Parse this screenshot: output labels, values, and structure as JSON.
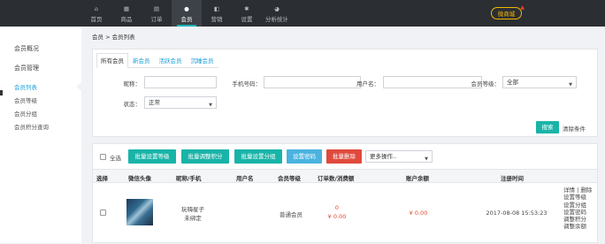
{
  "topnav": [
    {
      "label": "首页",
      "icon": "home-icon",
      "glyph": "⌂"
    },
    {
      "label": "商品",
      "icon": "goods-icon",
      "glyph": "▦"
    },
    {
      "label": "订单",
      "icon": "order-icon",
      "glyph": "▤"
    },
    {
      "label": "会员",
      "icon": "member-icon",
      "glyph": "●"
    },
    {
      "label": "营销",
      "icon": "marketing-icon",
      "glyph": "◧"
    },
    {
      "label": "设置",
      "icon": "settings-icon",
      "glyph": "✱"
    },
    {
      "label": "分析统计",
      "icon": "analytics-icon",
      "glyph": "◕"
    }
  ],
  "topnav_active": "会员",
  "weishop_label": "微商城",
  "sidebar": {
    "overview": "会员概况",
    "manage_group": "会员管理",
    "links": [
      "会员列表",
      "会员等级",
      "会员分组",
      "会员积分查询"
    ],
    "active": "会员列表"
  },
  "breadcrumb": "会员 > 会员列表",
  "tabs": [
    "所有会员",
    "新会员",
    "活跃会员",
    "沉睡会员"
  ],
  "tab_active": "所有会员",
  "filters": {
    "nickname_label": "昵称：",
    "nickname_value": "",
    "phone_label": "手机号码：",
    "phone_value": "",
    "username_label": "用户名：",
    "username_value": "",
    "level_label": "会员等级：",
    "level_value": "全部",
    "status_label": "状态：",
    "status_value": "正常"
  },
  "search_button": "搜索",
  "clear_link": "清除条件",
  "bulk": {
    "select_all": "全选",
    "btn_level": "批量设置等级",
    "btn_points": "批量调整积分",
    "btn_group": "批量设置分组",
    "btn_password": "设置密码",
    "btn_delete": "批量删除",
    "more_ops": "更多操作.."
  },
  "columns": [
    "选择",
    "微信头像",
    "昵称/手机",
    "用户名",
    "会员等级",
    "订单数/消费额",
    "账户余额",
    "注册时间"
  ],
  "rows": [
    {
      "nickname": "玩嗨星子",
      "phone": "未绑定",
      "username": "",
      "level": "普通会员",
      "order_count": "0",
      "spend": "¥ 0.00",
      "balance": "¥ 0.00",
      "registered": "2017-08-08 15:53:23",
      "actions": [
        "详情 | 删除",
        "设置等级",
        "设置分组",
        "设置密码",
        "调整积分",
        "调整余额"
      ]
    }
  ],
  "colors": {
    "topbar": "#2b2e33",
    "accent": "#19b4a8",
    "link": "#19a0d8",
    "danger": "#e04a3c",
    "gold": "#f2b600"
  }
}
